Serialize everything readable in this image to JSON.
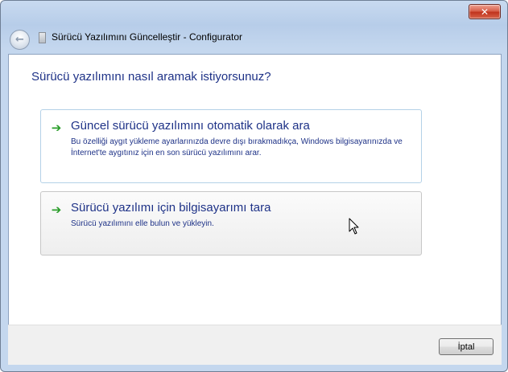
{
  "window": {
    "title": "Sürücü Yazılımını Güncelleştir - Configurator",
    "close_label": "✕"
  },
  "content": {
    "heading": "Sürücü yazılımını nasıl aramak istiyorsunuz?",
    "options": [
      {
        "title": "Güncel sürücü yazılımını otomatik olarak ara",
        "description": "Bu özelliği aygıt yükleme ayarlarınızda devre dışı bırakmadıkça, Windows bilgisayarınızda ve İnternet'te aygıtınız için en son sürücü yazılımını arar."
      },
      {
        "title": "Sürücü yazılımı için bilgisayarımı tara",
        "description": "Sürücü yazılımını elle bulun ve yükleyin."
      }
    ]
  },
  "footer": {
    "cancel_label": "İptal"
  },
  "icons": {
    "back": "back-arrow-icon",
    "window": "device-icon",
    "option_arrow": "green-arrow-icon",
    "cursor": "mouse-pointer-icon"
  }
}
